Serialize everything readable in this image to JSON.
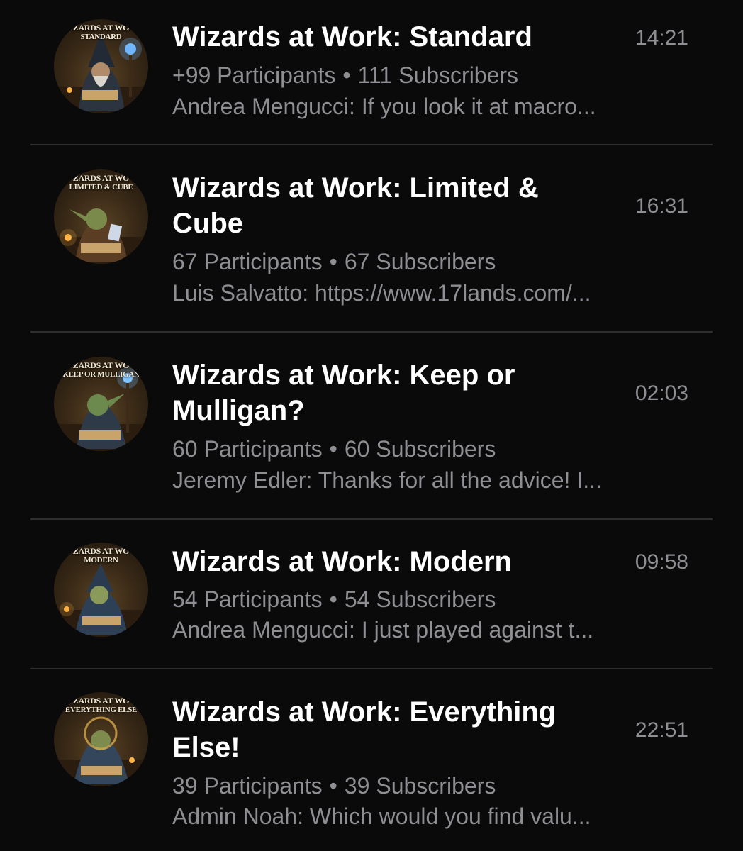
{
  "chats": [
    {
      "avatar_line1": "ZARDS AT WO",
      "avatar_line2": "STANDARD",
      "title": "Wizards at Work: Standard",
      "time": "14:21",
      "participants": "+99 Participants",
      "subscribers": "111 Subscribers",
      "preview": "Andrea Mengucci: If you look it at macro..."
    },
    {
      "avatar_line1": "ZARDS AT WO",
      "avatar_line2": "LIMITED & CUBE",
      "title": "Wizards at Work: Limited & Cube",
      "time": "16:31",
      "participants": "67 Participants",
      "subscribers": "67 Subscribers",
      "preview": "Luis Salvatto: https://www.17lands.com/..."
    },
    {
      "avatar_line1": "ZARDS AT WO",
      "avatar_line2": "KEEP OR MULLIGAN",
      "title": "Wizards at Work: Keep or Mulligan?",
      "time": "02:03",
      "participants": "60 Participants",
      "subscribers": "60 Subscribers",
      "preview": "Jeremy Edler: Thanks for all the advice! I..."
    },
    {
      "avatar_line1": "ZARDS AT WO",
      "avatar_line2": "MODERN",
      "title": "Wizards at Work: Modern",
      "time": "09:58",
      "participants": "54 Participants",
      "subscribers": "54 Subscribers",
      "preview": "Andrea Mengucci: I just played against t..."
    },
    {
      "avatar_line1": "ZARDS AT WO",
      "avatar_line2": "EVERYTHING ELSE",
      "title": "Wizards at Work: Everything Else!",
      "time": "22:51",
      "participants": "39 Participants",
      "subscribers": "39 Subscribers",
      "preview": "Admin Noah: Which would you find valu..."
    }
  ],
  "separator": "•",
  "colors": {
    "background": "#0a0a0b",
    "title": "#ffffff",
    "secondary": "#8e8e93",
    "divider": "#2e2e31"
  }
}
